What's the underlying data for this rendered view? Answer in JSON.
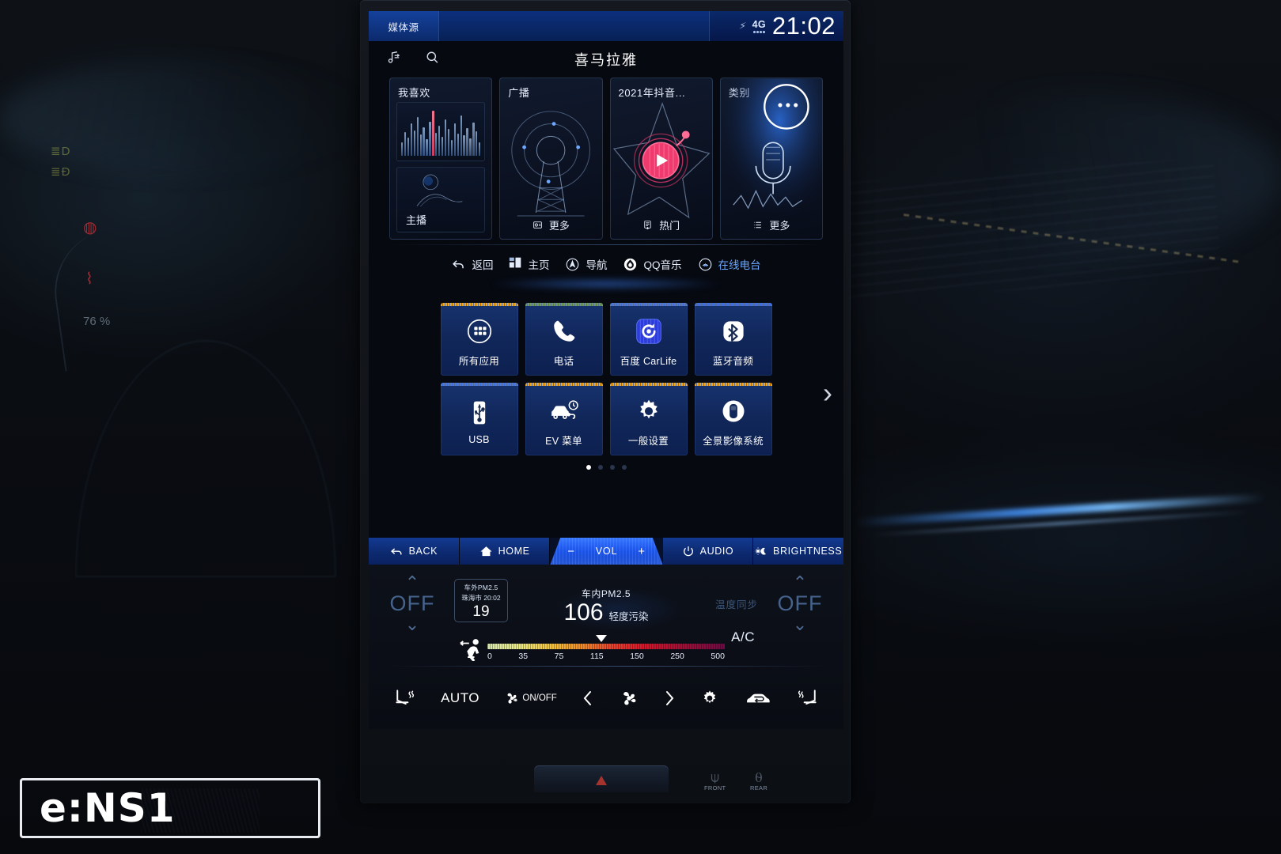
{
  "statusbar": {
    "source_label": "媒体源",
    "network": "4G",
    "time": "21:02"
  },
  "media_header": {
    "title": "喜马拉雅",
    "playlist_icon": "playlist-music-icon",
    "search_icon": "search-icon"
  },
  "media_cards": [
    {
      "title": "我喜欢",
      "footer": "主播",
      "art": "equalizer"
    },
    {
      "title": "广播",
      "footer": "更多",
      "art": "radio-tower"
    },
    {
      "title": "2021年抖音...",
      "footer": "热门",
      "art": "star-record"
    },
    {
      "title": "类别",
      "footer": "更多",
      "art": "microphone"
    }
  ],
  "nav_strip": [
    {
      "label": "返回",
      "icon": "back-arrow-icon",
      "active": false
    },
    {
      "label": "主页",
      "icon": "home-grid-icon",
      "active": false
    },
    {
      "label": "导航",
      "icon": "navigation-compass-icon",
      "active": false
    },
    {
      "label": "QQ音乐",
      "icon": "qq-music-icon",
      "active": false
    },
    {
      "label": "在线电台",
      "icon": "online-radio-icon",
      "active": true
    }
  ],
  "apps": [
    {
      "label": "所有应用",
      "icon": "all-apps-icon",
      "accent": "#f0a81e"
    },
    {
      "label": "电话",
      "icon": "phone-icon",
      "accent": "#6f9c5e"
    },
    {
      "label": "百度 CarLife",
      "icon": "carlife-icon",
      "accent": "#4f79d6"
    },
    {
      "label": "蓝牙音频",
      "icon": "bluetooth-icon",
      "accent": "#3f6fd8"
    },
    {
      "label": "USB",
      "icon": "usb-icon",
      "accent": "#4a7ae0"
    },
    {
      "label": "EV 菜单",
      "icon": "ev-car-icon",
      "accent": "#f0a81e"
    },
    {
      "label": "一般设置",
      "icon": "settings-gear-icon",
      "accent": "#f0a81e"
    },
    {
      "label": "全景影像系统",
      "icon": "panoramic-view-icon",
      "accent": "#f0a81e"
    }
  ],
  "pagination": {
    "total": 4,
    "active": 1
  },
  "toolbar": {
    "back": "BACK",
    "home": "HOME",
    "vol": "VOL",
    "vol_minus": "−",
    "vol_plus": "+",
    "audio": "AUDIO",
    "brightness": "BRIGHTNESS"
  },
  "hvac": {
    "left_temp": "OFF",
    "right_temp": "OFF",
    "sync_label": "温度同步",
    "ac_label": "A/C",
    "outside_pm": {
      "label": "车外PM2.5",
      "city_time": "珠海市 20:02",
      "value": "19"
    },
    "inside_pm": {
      "label": "车内PM2.5",
      "value": "106",
      "quality": "轻度污染",
      "marker_percent": 48
    },
    "scale_ticks": [
      "0",
      "35",
      "75",
      "115",
      "150",
      "250",
      "500"
    ],
    "controls": [
      {
        "label": "",
        "icon": "seat-heat-left-icon"
      },
      {
        "label": "AUTO",
        "icon": "auto-icon"
      },
      {
        "label": "ON/OFF",
        "icon": "fan-onoff-icon"
      },
      {
        "label": "",
        "icon": "chevron-left-icon"
      },
      {
        "label": "",
        "icon": "fan-speed-icon"
      },
      {
        "label": "",
        "icon": "chevron-right-icon"
      },
      {
        "label": "",
        "icon": "hvac-settings-gear-icon"
      },
      {
        "label": "",
        "icon": "air-recirculation-icon"
      },
      {
        "label": "",
        "icon": "seat-heat-right-icon"
      }
    ]
  },
  "physical": {
    "hazard": "hazard-triangle-icon",
    "front_defog": "FRONT",
    "rear_defog": "REAR"
  },
  "badge": {
    "text": "e:NS1"
  },
  "colors": {
    "screen_blue": "#1745c8",
    "accent_orange": "#f0a81e",
    "active_nav": "#69a8ff",
    "pink_record": "#ef3a6e"
  },
  "cluster": {
    "percent": "76 %"
  }
}
